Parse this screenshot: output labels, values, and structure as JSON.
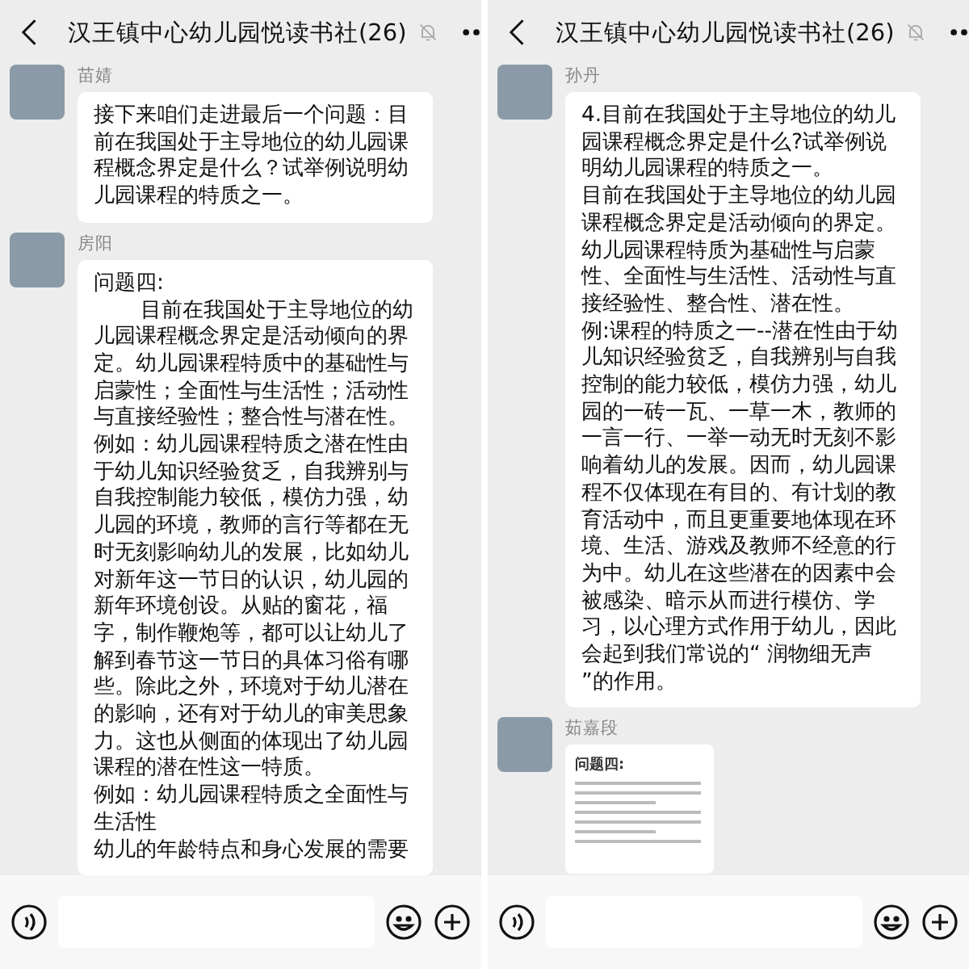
{
  "panels": [
    {
      "title": "汉王镇中心幼儿园悦读书社(26)",
      "muted": true,
      "messages": [
        {
          "kind": "text",
          "sender": "苗婧",
          "paragraphs": [
            {
              "text": "接下来咱们走进最后一个问题：目前在我国处于主导地位的幼儿园课程概念界定是什么？试举例说明幼儿园课程的特质之一。",
              "indent": false
            }
          ]
        },
        {
          "kind": "text",
          "sender": "房阳",
          "paragraphs": [
            {
              "text": "问题四:",
              "indent": false
            },
            {
              "text": "目前在我国处于主导地位的幼儿园课程概念界定是活动倾向的界定。幼儿园课程特质中的基础性与启蒙性；全面性与生活性；活动性与直接经验性；整合性与潜在性。",
              "indent": true
            },
            {
              "text": "例如：幼儿园课程特质之潜在性由于幼儿知识经验贫乏，自我辨别与自我控制能力较低，模仿力强，幼儿园的环境，教师的言行等都在无时无刻影响幼儿的发展，比如幼儿对新年这一节日的认识，幼儿园的新年环境创设。从贴的窗花，福字，制作鞭炮等，都可以让幼儿了解到春节这一节日的具体习俗有哪些。除此之外，环境对于幼儿潜在的影响，还有对于幼儿的审美思象力。这也从侧面的体现出了幼儿园课程的潜在性这一特质。",
              "indent": false
            },
            {
              "text": "例如：幼儿园课程特质之全面性与生活性",
              "indent": false
            },
            {
              "text": "幼儿的年龄特点和身心发展的需要",
              "indent": false
            }
          ]
        }
      ]
    },
    {
      "title": "汉王镇中心幼儿园悦读书社(26)",
      "muted": true,
      "messages": [
        {
          "kind": "text",
          "sender": "孙丹",
          "paragraphs": [
            {
              "text": "4.目前在我国处于主导地位的幼儿园课程概念界定是什么?试举例说明幼儿园课程的特质之一。",
              "indent": false
            },
            {
              "text": "目前在我国处于主导地位的幼儿园课程概念界定是活动倾向的界定。",
              "indent": false
            },
            {
              "text": "幼儿园课程特质为基础性与启蒙性、全面性与生活性、活动性与直接经验性、整合性、潜在性。",
              "indent": false
            },
            {
              "text": "例:课程的特质之一--潜在性由于幼儿知识经验贫乏，自我辨别与自我控制的能力较低，模仿力强，幼儿园的一砖一瓦、一草一木，教师的一言一行、一举一动无时无刻不影响着幼儿的发展。因而，幼儿园课程不仅体现在有目的、有计划的教育活动中，而且更重要地体现在环境、生活、游戏及教师不经意的行为中。幼儿在这些潜在的因素中会被感染、暗示从而进行模仿、学习，以心理方式作用于幼儿，因此会起到我们常说的“ 润物细无声 ”的作用。",
              "indent": false
            }
          ]
        },
        {
          "kind": "image",
          "sender": "茹嘉段",
          "heading": "问题四:"
        }
      ]
    }
  ]
}
